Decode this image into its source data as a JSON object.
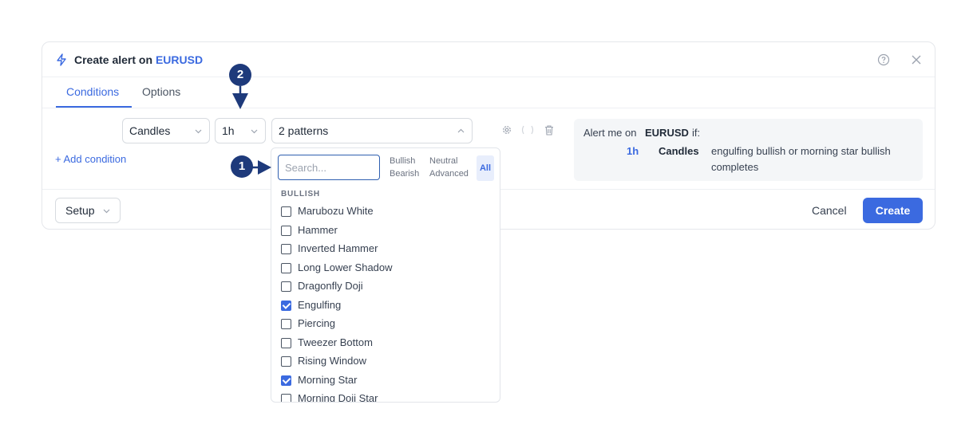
{
  "dialog": {
    "title_prefix": "Create alert on ",
    "symbol": "EURUSD",
    "icons": {
      "title": "bolt-icon",
      "help": "help-circle-icon",
      "close": "close-icon"
    }
  },
  "tabs": [
    {
      "label": "Conditions",
      "active": true
    },
    {
      "label": "Options",
      "active": false
    }
  ],
  "condition": {
    "source": "Candles",
    "timeframe": "1h",
    "patterns_value": "2 patterns",
    "icons": [
      "gear-icon",
      "brackets-icon",
      "trash-icon"
    ]
  },
  "add_condition_label": "+ Add condition",
  "summary": {
    "prefix": "Alert me on",
    "symbol": "EURUSD",
    "suffix": "if:",
    "timeframe": "1h",
    "source": "Candles",
    "description": "engulfing bullish or morning star bullish completes"
  },
  "footer": {
    "setup_label": "Setup",
    "cancel_label": "Cancel",
    "create_label": "Create"
  },
  "dropdown": {
    "search_placeholder": "Search...",
    "filters": [
      "Bullish",
      "Bearish",
      "Neutral",
      "Advanced",
      "All"
    ],
    "active_filter": "All",
    "group_header": "BULLISH",
    "options": [
      {
        "label": "Marubozu White",
        "checked": false
      },
      {
        "label": "Hammer",
        "checked": false
      },
      {
        "label": "Inverted Hammer",
        "checked": false
      },
      {
        "label": "Long Lower Shadow",
        "checked": false
      },
      {
        "label": "Dragonfly Doji",
        "checked": false
      },
      {
        "label": "Engulfing",
        "checked": true
      },
      {
        "label": "Piercing",
        "checked": false
      },
      {
        "label": "Tweezer Bottom",
        "checked": false
      },
      {
        "label": "Rising Window",
        "checked": false
      },
      {
        "label": "Morning Star",
        "checked": true
      },
      {
        "label": "Morning Doji Star",
        "checked": false
      }
    ]
  },
  "annotations": [
    {
      "number": "1"
    },
    {
      "number": "2"
    }
  ],
  "colors": {
    "accent": "#3b6ae0",
    "badge": "#1e3a7b"
  }
}
